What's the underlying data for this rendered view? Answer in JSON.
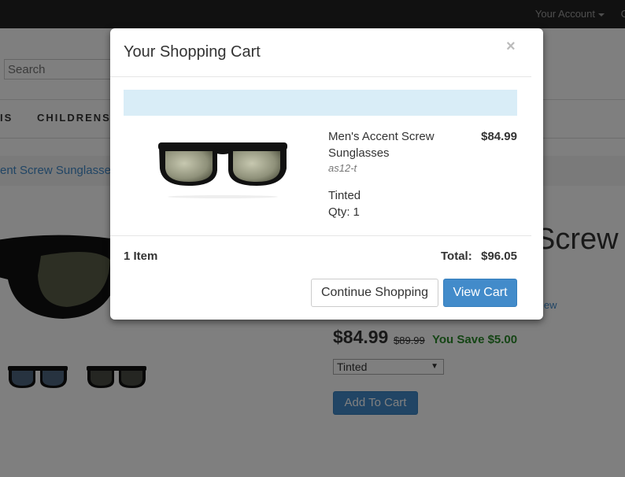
{
  "header": {
    "account_label": "Your Account",
    "edge_glyph": "C"
  },
  "page": {
    "search_placeholder": "Search",
    "nav_fragment": "IS",
    "nav_children": "CHILDRENS",
    "breadcrumb": "ent Screw Sunglasses",
    "title_fragment": "Screw",
    "review_fragment": "iew",
    "price": "$84.99",
    "old_price": "$89.99",
    "you_save": "You Save $5.00",
    "variant_selected": "Tinted",
    "add_to_cart": "Add To Cart"
  },
  "modal": {
    "title": "Your Shopping Cart",
    "close_glyph": "×",
    "item": {
      "name": "Men's Accent Screw Sunglasses",
      "sku": "as12-t",
      "option": "Tinted",
      "qty_label": "Qty:",
      "qty_value": "1",
      "price": "$84.99"
    },
    "summary": {
      "items": "1 Item",
      "total_label": "Total:",
      "total_value": "$96.05"
    },
    "buttons": {
      "continue": "Continue Shopping",
      "view_cart": "View Cart"
    }
  },
  "colors": {
    "accent": "#428bca",
    "alert_bg": "#d9edf7",
    "savings": "#2a8a2a",
    "topbar": "#222222"
  }
}
